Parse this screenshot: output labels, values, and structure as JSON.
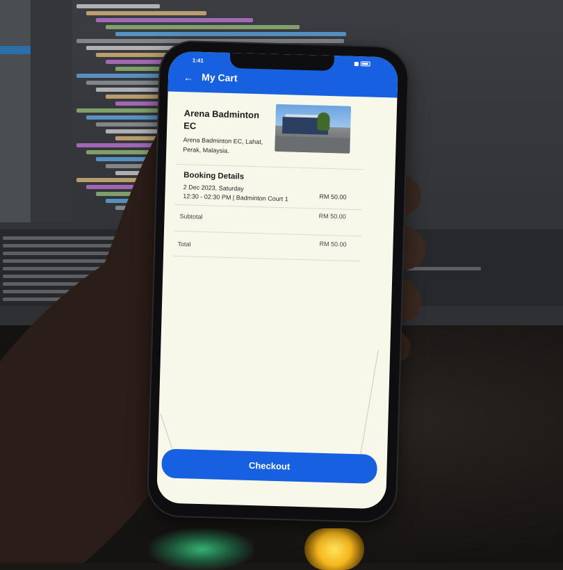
{
  "status_bar": {
    "time": "1:41"
  },
  "app_bar": {
    "title": "My Cart",
    "back_icon": "arrow-left-icon"
  },
  "venue": {
    "name": "Arena Badminton EC",
    "address": "Arena Badminton EC, Lahat, Perak, Malaysia."
  },
  "booking": {
    "title": "Booking Details",
    "date": "2 Dec 2023, Saturday",
    "slot": "12:30 - 02:30 PM | Badminton Court 1",
    "price": "RM 50.00"
  },
  "summary": {
    "subtotal_label": "Subtotal",
    "subtotal_value": "RM 50.00",
    "total_label": "Total",
    "total_value": "RM 50.00"
  },
  "checkout_label": "Checkout",
  "colors": {
    "primary": "#1761e0",
    "screen_background": "#f7f8ea",
    "keyboard_glow": "#3fd88b",
    "lamp": "#ffd23a"
  }
}
